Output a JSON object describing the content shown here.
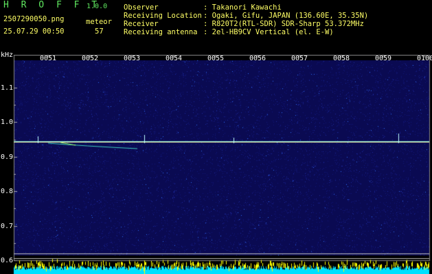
{
  "header": {
    "app_title": "H R O F F T",
    "version": "1.0.0",
    "filename": "2507290050.png",
    "datetime": "25.07.29 00:50",
    "counter_label": "meteor",
    "counter_value": "57",
    "info": [
      {
        "label": "Observer",
        "value": ": Takanori Kawachi"
      },
      {
        "label": "Receiving Location",
        "value": ": Ogaki, Gifu, JAPAN (136.60E, 35.35N)"
      },
      {
        "label": "Receiver",
        "value": ": R820T2(RTL-SDR) SDR-Sharp 53.372MHz"
      },
      {
        "label": "Receiving antenna",
        "value": ": 2el-HB9CV Vertical (el. E-W)"
      }
    ]
  },
  "chart_data": {
    "type": "heatmap",
    "ylabel": "kHz",
    "x_ticks": [
      "0051",
      "0052",
      "0053",
      "0054",
      "0055",
      "0056",
      "0057",
      "0058",
      "0059",
      "0100"
    ],
    "y_ticks": [
      "1.1",
      "1.0",
      "0.9",
      "0.8",
      "0.7",
      "0.6"
    ],
    "ylim": [
      0.6,
      1.1
    ],
    "carrier_khz": 0.943,
    "colors": {
      "background": "#0a0a52",
      "carrier": "#ffffaa",
      "level": "#00e0ff",
      "level_peak": "#ffff00"
    }
  }
}
